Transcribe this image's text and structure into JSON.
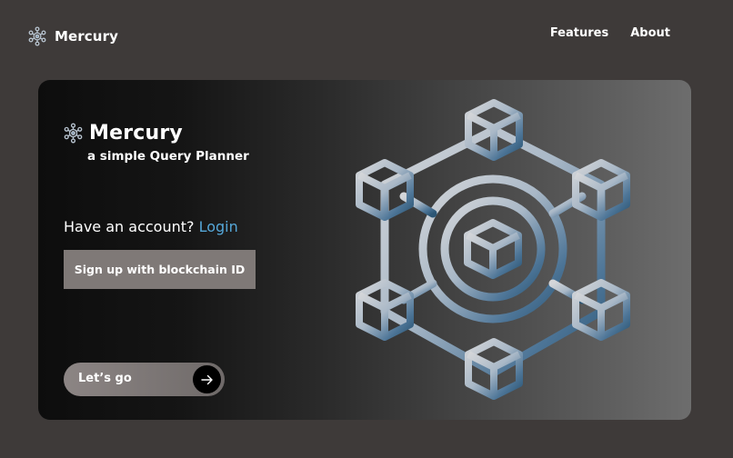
{
  "header": {
    "brand_name": "Mercury",
    "brand_icon": "gear-cluster-logo-icon",
    "nav": [
      {
        "label": "Features"
      },
      {
        "label": "About"
      }
    ]
  },
  "hero": {
    "title": "Mercury",
    "subtitle": "a simple Query Planner",
    "account_prompt": "Have an account?",
    "login_label": "Login",
    "signup_label": "Sign up with blockchain ID",
    "cta_label": "Let’s go",
    "cta_icon": "arrow-right-icon",
    "illustration": "blockchain-network-icon"
  },
  "colors": {
    "page_background": "#3e3a39",
    "link": "#55a7d8",
    "button_background": "#7f7977",
    "illustration_light": "#d4d6d9",
    "illustration_dark": "#2c5675"
  }
}
